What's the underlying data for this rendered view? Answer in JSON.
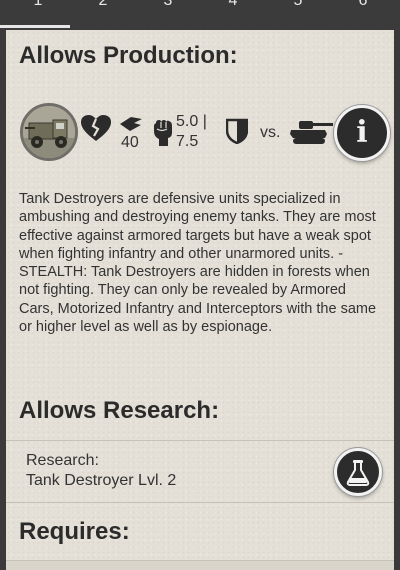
{
  "tabs": [
    "1",
    "2",
    "3",
    "4",
    "5",
    "6"
  ],
  "sections": {
    "production_title": "Allows Production:",
    "research_title": "Allows Research:",
    "requires_title": "Requires:"
  },
  "unit_stats": {
    "speed": "40",
    "attack_top": "5.0 |",
    "attack_bottom": "7.5",
    "versus_label": "vs."
  },
  "description": "Tank Destroyers are defensive units specialized in ambushing and destroying enemy tanks. They are most effective against armored targets but have a weak spot when fighting infantry and other unarmored units. - STEALTH: Tank Destroyers are hidden in forests when not fighting. They can only be revealed by Armored Cars, Motorized Infantry and Interceptors with the same or higher level as well as by espionage.",
  "research": {
    "label": "Research:",
    "item": "Tank Destroyer Lvl. 2"
  },
  "icons": {
    "unit": "tank-destroyer-unit-icon",
    "health": "broken-heart-icon",
    "speed": "speed-wing-icon",
    "attack": "fist-icon",
    "defense": "shield-icon",
    "target": "tank-icon",
    "info": "info-icon",
    "research": "flask-icon"
  },
  "colors": {
    "tab_bar": "#3b3b3b",
    "panel": "#e4e0d7",
    "text": "#333333",
    "button": "#2c2c2c"
  }
}
